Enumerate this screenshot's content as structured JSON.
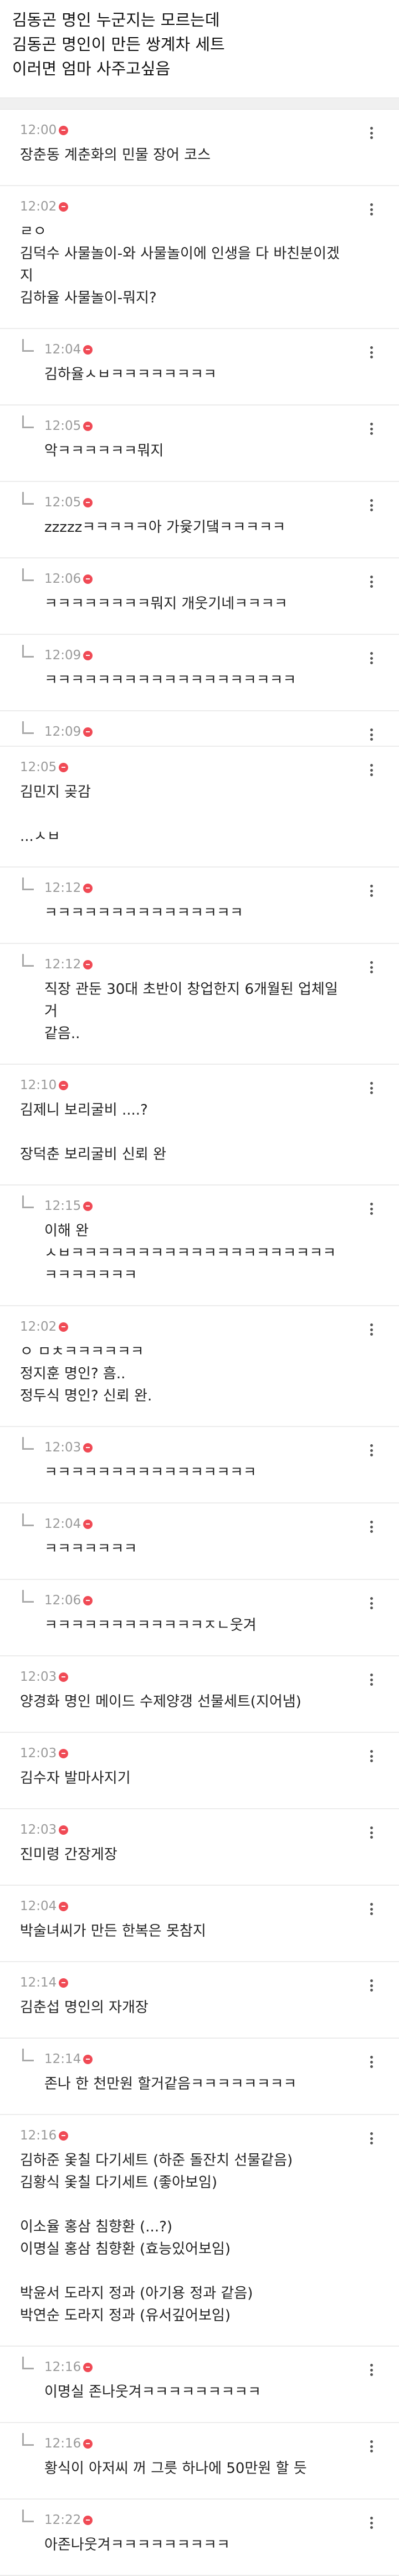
{
  "post": {
    "lines": [
      "김동곤 명인 누군지는 모르는데",
      "김동곤 명인이 만든 쌍계차 세트",
      "이러면 엄마 사주고싶음"
    ]
  },
  "comments": [
    {
      "time": "12:00",
      "reply": false,
      "lines": [
        "장춘동 계춘화의 민물 장어 코스"
      ]
    },
    {
      "time": "12:02",
      "reply": false,
      "lines": [
        "ㄹㅇ",
        "김덕수 사물놀이-와 사물놀이에 인생을 다 바친분이겠지",
        "김하율 사물놀이-뭐지?"
      ]
    },
    {
      "time": "12:04",
      "reply": true,
      "lines": [
        "김하율ㅅㅂㅋㅋㅋㅋㅋㅋㅋㅋ"
      ]
    },
    {
      "time": "12:05",
      "reply": true,
      "lines": [
        "악ㅋㅋㅋㅋㅋㅋ뭐지"
      ]
    },
    {
      "time": "12:05",
      "reply": true,
      "lines": [
        "zzzzzㅋㅋㅋㅋㅋ아 가윷기댘ㅋㅋㅋㅋㅋ"
      ]
    },
    {
      "time": "12:06",
      "reply": true,
      "lines": [
        "ㅋㅋㅋㅋㅋㅋㅋㅋ뭐지 개웃기네ㅋㅋㅋㅋ"
      ]
    },
    {
      "time": "12:09",
      "reply": true,
      "lines": [
        "ㅋㅋㅋㅋㅋㅋㅋㅋㅋㅋㅋㅋㅋㅋㅋㅋㅋㅋㅋ"
      ]
    },
    {
      "time": "12:09",
      "reply": true,
      "lines": []
    },
    {
      "time": "12:05",
      "reply": false,
      "lines": [
        "김민지 곶감",
        "",
        "...ㅅㅂ"
      ]
    },
    {
      "time": "12:12",
      "reply": true,
      "lines": [
        "ㅋㅋㅋㅋㅋㅋㅋㅋㅋㅋㅋㅋㅋㅋㅋ"
      ]
    },
    {
      "time": "12:12",
      "reply": true,
      "lines": [
        "직장 관둔 30대 초반이 창업한지 6개월된 업체일 거",
        "같음.."
      ]
    },
    {
      "time": "12:10",
      "reply": false,
      "lines": [
        "김제니 보리굴비 ....?",
        "",
        "장덕춘 보리굴비 신뢰 완"
      ]
    },
    {
      "time": "12:15",
      "reply": true,
      "lines": [
        "이해 완",
        "ㅅㅂㅋㅋㅋㅋㅋㅋㅋㅋㅋㅋㅋㅋㅋㅋㅋㅋㅋㅋㅋㅋ",
        "ㅋㅋㅋㅋㅋㅋㅋ"
      ]
    },
    {
      "time": "12:02",
      "reply": false,
      "lines": [
        "ㅇ ㅁㅊㅋㅋㅋㅋㅋㅋ",
        "정지훈 명인? 흠..",
        "정두식 명인? 신뢰 완."
      ]
    },
    {
      "time": "12:03",
      "reply": true,
      "lines": [
        "ㅋㅋㅋㅋㅋㅋㅋㅋㅋㅋㅋㅋㅋㅋㅋㅋ"
      ]
    },
    {
      "time": "12:04",
      "reply": true,
      "lines": [
        "ㅋㅋㅋㅋㅋㅋㅋ"
      ]
    },
    {
      "time": "12:06",
      "reply": true,
      "lines": [
        "ㅋㅋㅋㅋㅋㅋㅋㅋㅋㅋㅋㅋㅈㄴ웃겨"
      ]
    },
    {
      "time": "12:03",
      "reply": false,
      "lines": [
        "양경화 명인 메이드 수제양갱 선물세트(지어냄)"
      ]
    },
    {
      "time": "12:03",
      "reply": false,
      "lines": [
        "김수자 발마사지기"
      ]
    },
    {
      "time": "12:03",
      "reply": false,
      "lines": [
        "진미령 간장게장"
      ]
    },
    {
      "time": "12:04",
      "reply": false,
      "lines": [
        "박술녀씨가 만든 한복은 못참지"
      ]
    },
    {
      "time": "12:14",
      "reply": false,
      "lines": [
        "김춘섭 명인의 자개장"
      ]
    },
    {
      "time": "12:14",
      "reply": true,
      "lines": [
        "존나 한 천만원 할거같음ㅋㅋㅋㅋㅋㅋㅋㅋ"
      ]
    },
    {
      "time": "12:16",
      "reply": false,
      "lines": [
        "김하준 옻칠 다기세트 (하준 돌잔치 선물같음)",
        "김황식 옻칠 다기세트 (좋아보임)",
        "",
        "이소율 홍삼 침향환 (...?)",
        "이명실 홍삼 침향환 (효능있어보임)",
        "",
        "박윤서 도라지 정과 (아기용 정과 같음)",
        "박연순 도라지 정과 (유서깊어보임)"
      ]
    },
    {
      "time": "12:16",
      "reply": true,
      "lines": [
        "이명실 존나웃겨ㅋㅋㅋㅋㅋㅋㅋㅋㅋ"
      ]
    },
    {
      "time": "12:16",
      "reply": true,
      "lines": [
        "황식이 아저씨 꺼 그릇 하나에 50만원 할 듯"
      ]
    },
    {
      "time": "12:22",
      "reply": true,
      "lines": [
        "아존나웃겨ㅋㅋㅋㅋㅋㅋㅋㅋㅋ"
      ]
    }
  ]
}
